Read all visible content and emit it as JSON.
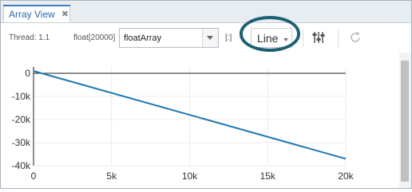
{
  "tab": {
    "label": "Array View",
    "close_glyph": "✖"
  },
  "toolbar": {
    "thread_label": "Thread: 1.1",
    "type_label": "float[20000]",
    "expression_value": "floatArray",
    "range_label": "[:]",
    "chart_type": "Line",
    "settings_icon": "sliders-icon",
    "refresh_icon": "refresh-icon"
  },
  "colors": {
    "line": "#1f77b4",
    "tab_accent": "#3a7dc4",
    "highlight": "#1d5f73"
  },
  "chart_data": {
    "type": "line",
    "series": [
      {
        "x": [
          0,
          20000
        ],
        "values": [
          1000,
          -37000
        ]
      }
    ],
    "xlim": [
      0,
      20000
    ],
    "ylim": [
      -40000,
      0
    ],
    "x_ticks": [
      "0",
      "5k",
      "10k",
      "15k",
      "20k"
    ],
    "y_ticks": [
      "0",
      "-10k",
      "-20k",
      "-30k",
      "-40k"
    ],
    "grid": true
  }
}
